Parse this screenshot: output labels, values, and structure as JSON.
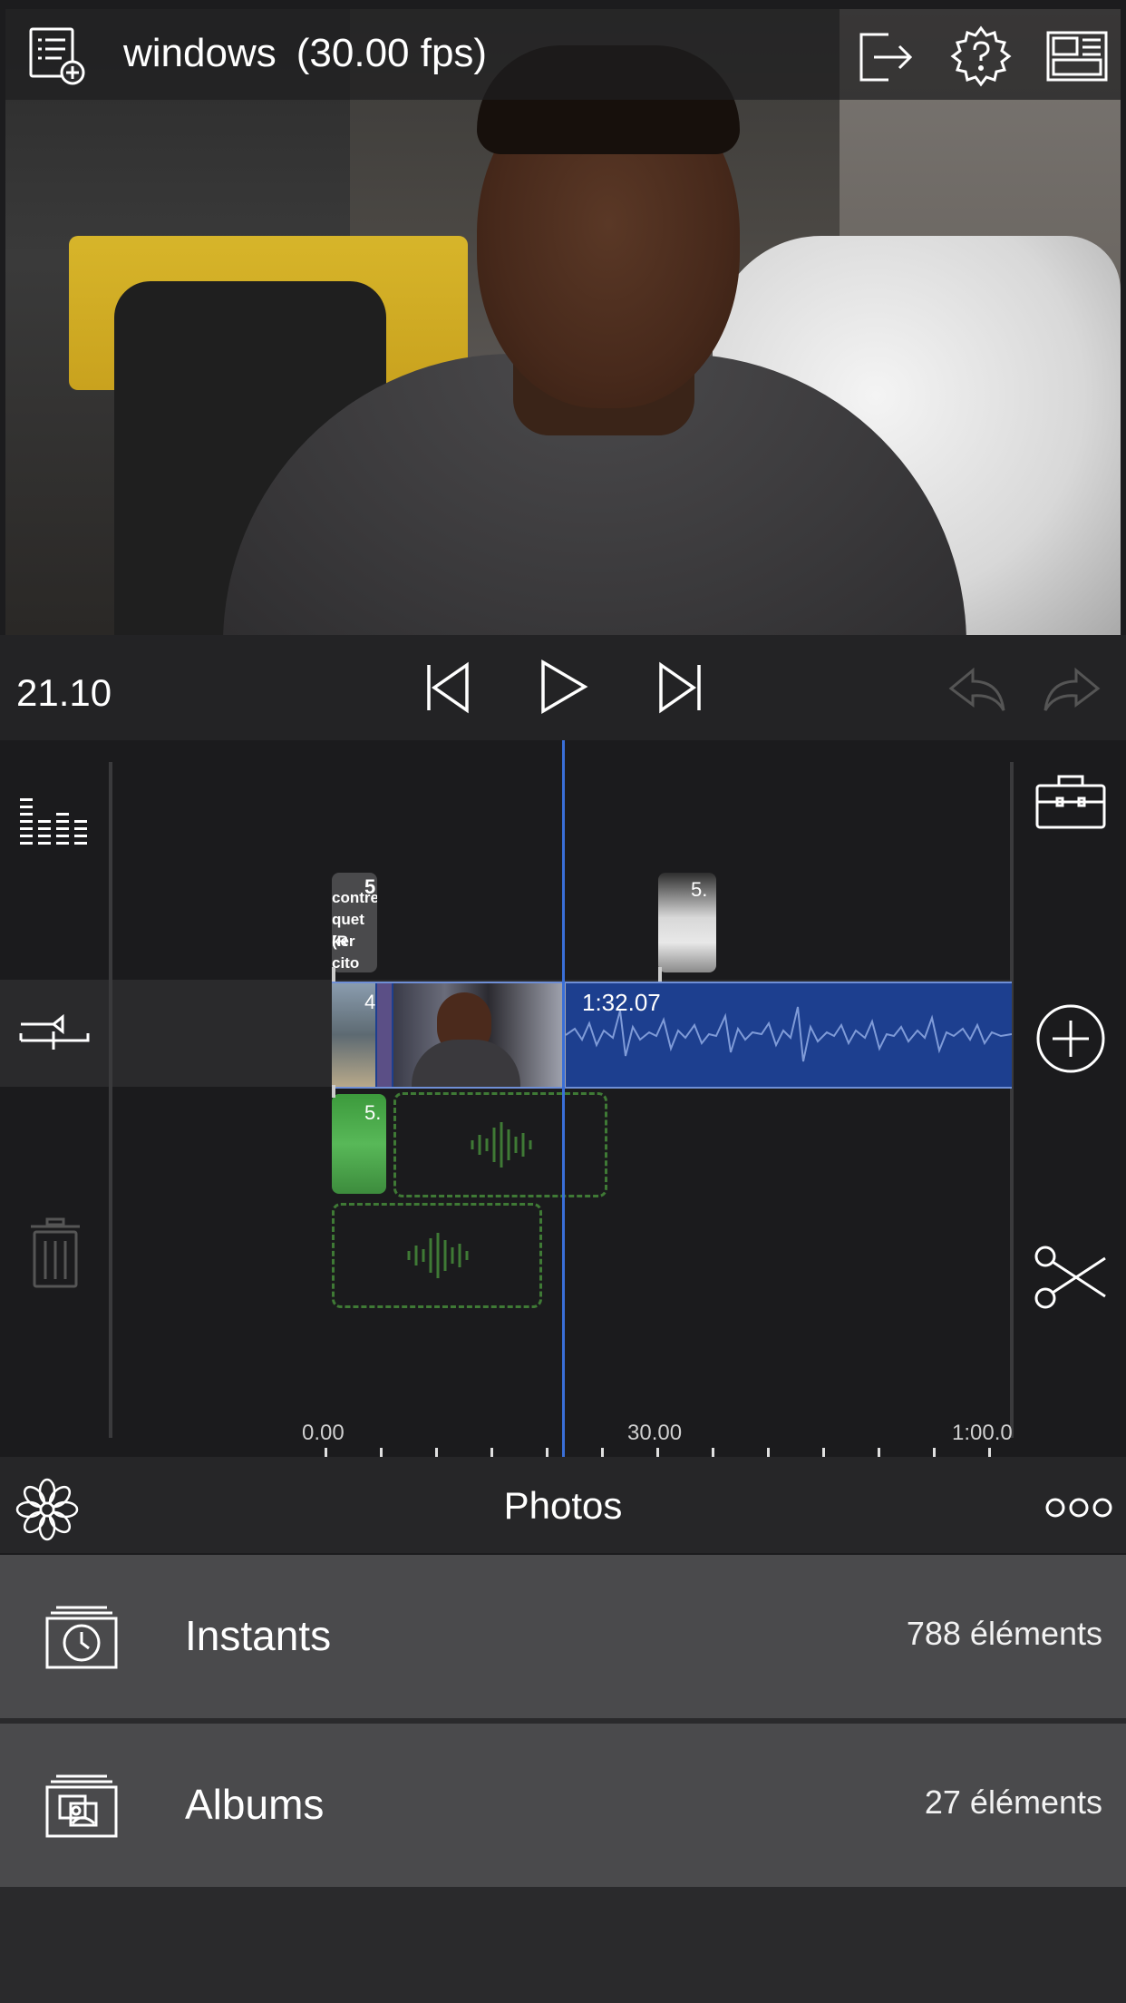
{
  "topbar": {
    "project_name": "windows",
    "fps": "(30.00 fps)",
    "icons": [
      "project-list-add-icon",
      "export-icon",
      "settings-help-icon",
      "layout-icon"
    ]
  },
  "transport": {
    "timecode": "21.10",
    "icons": [
      "skip-start-icon",
      "play-icon",
      "skip-end-icon",
      "undo-icon",
      "redo-icon"
    ]
  },
  "timeline": {
    "title_clip_1": {
      "lines": [
        "contre",
        "quet (R",
        "ker cito"
      ],
      "number": "5"
    },
    "title_clip_2": {
      "number": "5."
    },
    "main_clip_duration": "1:32.07",
    "main_clip_number": "4",
    "green_audio_number": "5.",
    "ruler": [
      "0.00",
      "30.00",
      "1:00.0"
    ],
    "left_tools": [
      "audio-levels-icon",
      "track-route-icon",
      "trash-icon"
    ],
    "right_tools": [
      "toolbox-icon",
      "add-icon",
      "scissors-icon"
    ]
  },
  "media": {
    "header_title": "Photos",
    "rows": [
      {
        "label": "Instants",
        "count": "788 éléments",
        "icon": "moments-icon"
      },
      {
        "label": "Albums",
        "count": "27 éléments",
        "icon": "albums-icon"
      }
    ]
  }
}
